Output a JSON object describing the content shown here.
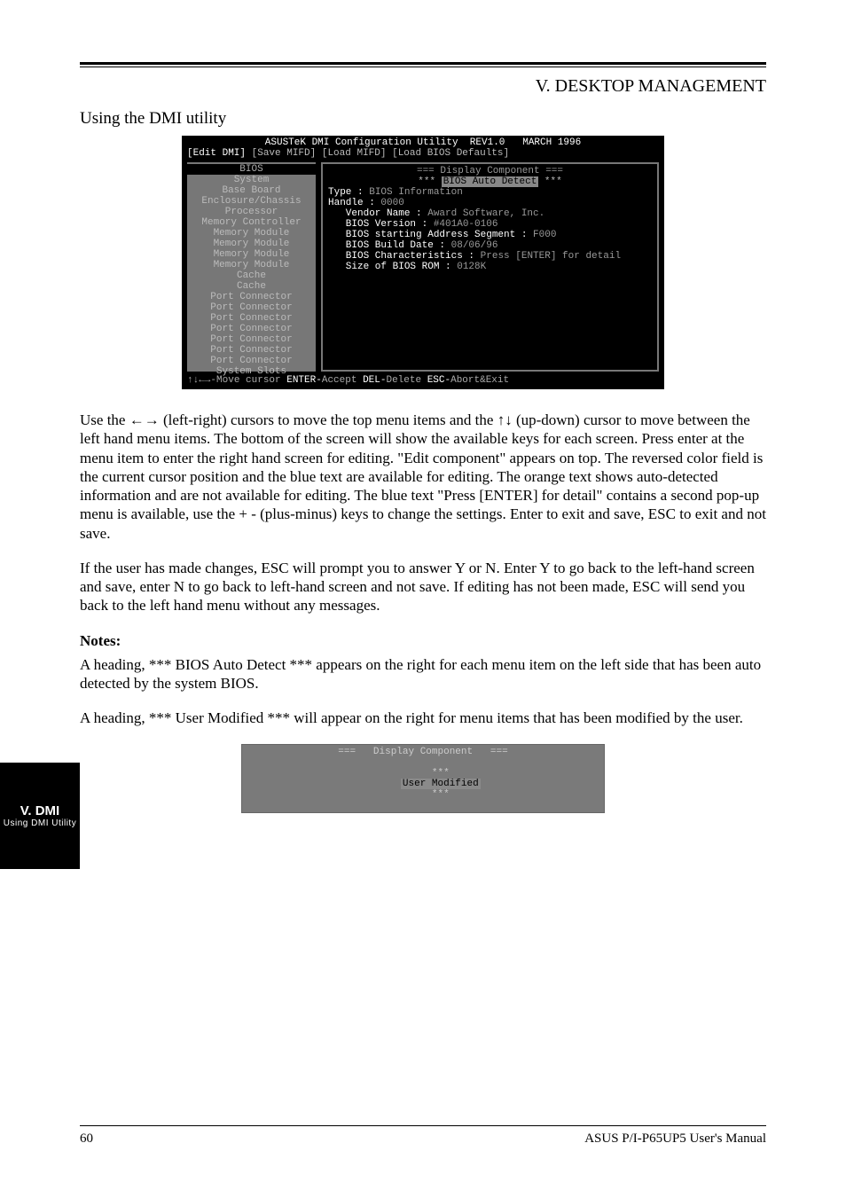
{
  "header": {
    "section_title": "V. DESKTOP MANAGEMENT",
    "subheading": "Using the DMI utility"
  },
  "bios_title": "ASUSTeK DMI Configuration Utility  REV1.0   MARCH 1996",
  "bios_menu": {
    "edit": "[Edit DMI]",
    "save": "[Save MIFD]",
    "load_mifd": "[Load MIFD]",
    "load_bios": "[Load BIOS Defaults]"
  },
  "left_items": [
    "BIOS",
    "System",
    "Base Board",
    "Enclosure/Chassis",
    "Processor",
    "Memory Controller",
    "Memory Module",
    "Memory Module",
    "Memory Module",
    "Memory Module",
    "Cache",
    "Cache",
    "Port Connector",
    "Port Connector",
    "Port Connector",
    "Port Connector",
    "Port Connector",
    "Port Connector",
    "Port Connector",
    "System Slots"
  ],
  "right_panel": {
    "header_title": "===   Display Component   ===",
    "auto_detect_stars": "***",
    "auto_detect": "BIOS Auto Detect",
    "type_label": "Type : ",
    "type_value": "BIOS Information",
    "handle_label": "Handle : ",
    "handle_value": "0000",
    "vendor_label": "   Vendor Name : ",
    "vendor_value": "Award Software, Inc.",
    "version_label": "   BIOS Version : ",
    "version_value": "#401A0-0106",
    "seg_label": "   BIOS starting Address Segment : ",
    "seg_value": "F000",
    "date_label": "   BIOS Build Date : ",
    "date_value": "08/06/96",
    "char_label": "   BIOS Characteristics : ",
    "char_value": "Press [ENTER] for detail",
    "size_label": "   Size of BIOS ROM : ",
    "size_value": "0128K"
  },
  "bios_footer": {
    "arrows": "↑↓←→-",
    "move": "Move cursor ",
    "enter": "ENTER-",
    "accept": "Accept ",
    "del": "DEL-",
    "delete": "Delete ",
    "esc": "ESC-",
    "abort": "Abort&Exit"
  },
  "paragraphs": {
    "p1": "Use the ←→ (left-right) cursors to move the top menu items and the ↑↓ (up-down) cursor to move between the left hand menu items. The bottom of the screen will show the available keys for each screen. Press enter at the menu item to enter the right hand screen for editing. \"Edit component\" appears on top. The reversed color field is the current cursor position and the blue text are available for editing. The orange text shows auto-detected information and are not available for editing. The blue text \"Press [ENTER] for detail\" contains a second pop-up menu is available, use the + - (plus-minus) keys to change the settings. Enter to exit and save, ESC to exit and not save.",
    "p2": "If the user has made changes, ESC will prompt you to answer Y or N. Enter Y to go back to the left-hand screen and save, enter N to go back to left-hand screen and not save. If editing has not been made, ESC will send you back to the left hand menu without any messages.",
    "notes_title": "Notes:",
    "p3": "A heading, *** BIOS Auto Detect *** appears on the right for each menu item on the left side that has been auto detected by the system BIOS.",
    "p4": "A heading, *** User Modified *** will appear on the right for menu items that has been modified by the user."
  },
  "snippet": {
    "line1": "===   Display Component   ===",
    "stars": "***",
    "um": "User Modified"
  },
  "side_tab": {
    "top": "V. DMI",
    "bottom": "Using DMI Utility"
  },
  "footer": {
    "page_num": "60",
    "product": "ASUS P/I-P65UP5 User's Manual"
  }
}
